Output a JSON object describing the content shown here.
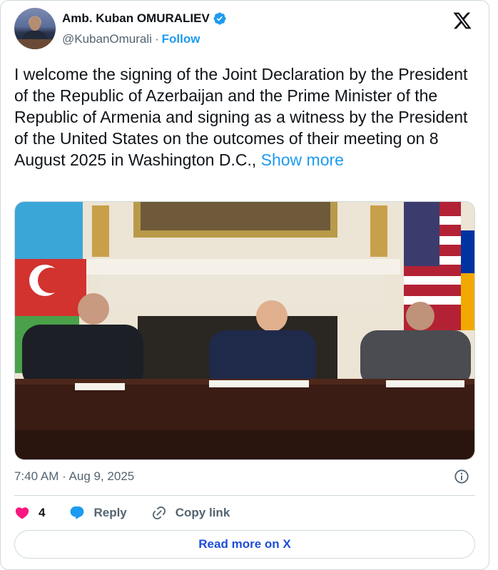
{
  "author": {
    "name": "Amb. Kuban OMURALIEV",
    "handle": "@KubanOmurali",
    "separator": "·",
    "follow_label": "Follow"
  },
  "icons": {
    "verified": "verified-badge-icon",
    "platform": "x-logo-icon",
    "info": "info-icon",
    "like": "heart-icon",
    "reply": "reply-bubble-icon",
    "copy_link": "link-icon"
  },
  "tweet": {
    "text": "I welcome the signing of the Joint Declaration by the President of the Republic of Azerbaijan and the Prime Minister of the Republic of Armenia and signing as a witness by the President of the United States on the outcomes of their meeting on 8 August 2025 in Washington D.C.,",
    "show_more_label": "Show more",
    "timestamp": "7:40 AM · Aug 9, 2025"
  },
  "actions": {
    "like_count": "4",
    "reply_label": "Reply",
    "copy_link_label": "Copy link"
  },
  "read_more_label": "Read more on X",
  "colors": {
    "accent": "#1d9bf0",
    "like": "#f91880",
    "text": "#0f1419",
    "secondary": "#536471",
    "border": "#cfd9de",
    "read_more": "#1d4ed8"
  }
}
